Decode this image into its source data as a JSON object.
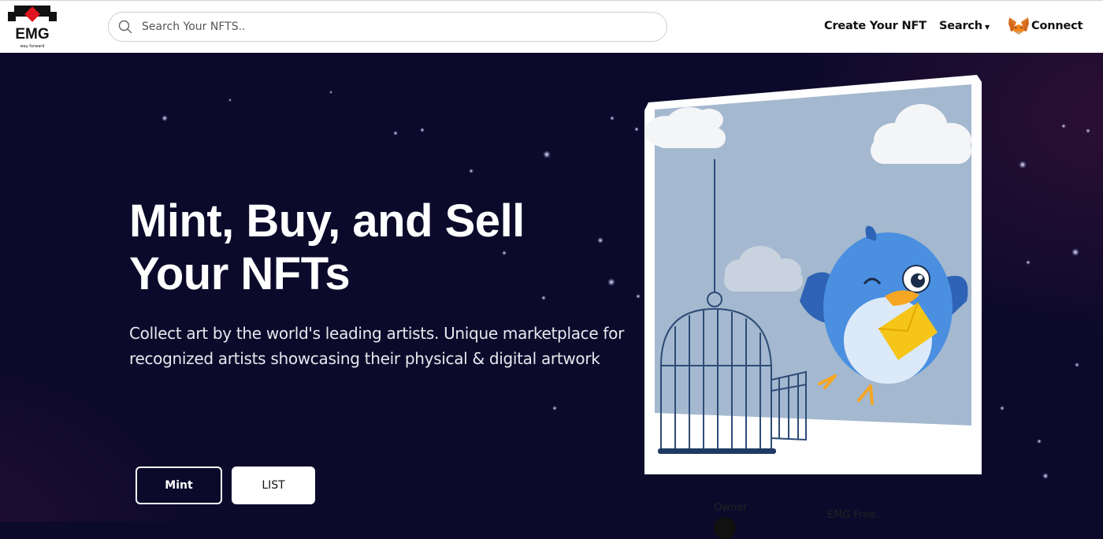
{
  "brand": {
    "name": "EMG",
    "tagline": "way forward"
  },
  "search": {
    "placeholder": "Search Your NFTS.."
  },
  "nav": {
    "create_label": "Create Your NFT",
    "search_label": "Search",
    "connect_label": "Connect"
  },
  "hero": {
    "title": "Mint, Buy, and Sell Your NFTs",
    "subtitle": "Collect art by the world's leading artists. Unique marketplace for recognized artists showcasing their physical & digital artwork",
    "mint_label": "Mint",
    "list_label": "LIST"
  },
  "card": {
    "owner_label": "Owner",
    "collection": "EMG Free.."
  },
  "colors": {
    "hero_bg": "#0c0a2b",
    "navbar_bg": "#ffffff",
    "brand_red": "#e0141f",
    "art_bg": "#a4b8cf",
    "bird_blue": "#4a8fe0",
    "envelope_yellow": "#f5c518"
  },
  "icons": [
    "search-icon",
    "caret-down-icon",
    "metamask-fox-icon"
  ]
}
